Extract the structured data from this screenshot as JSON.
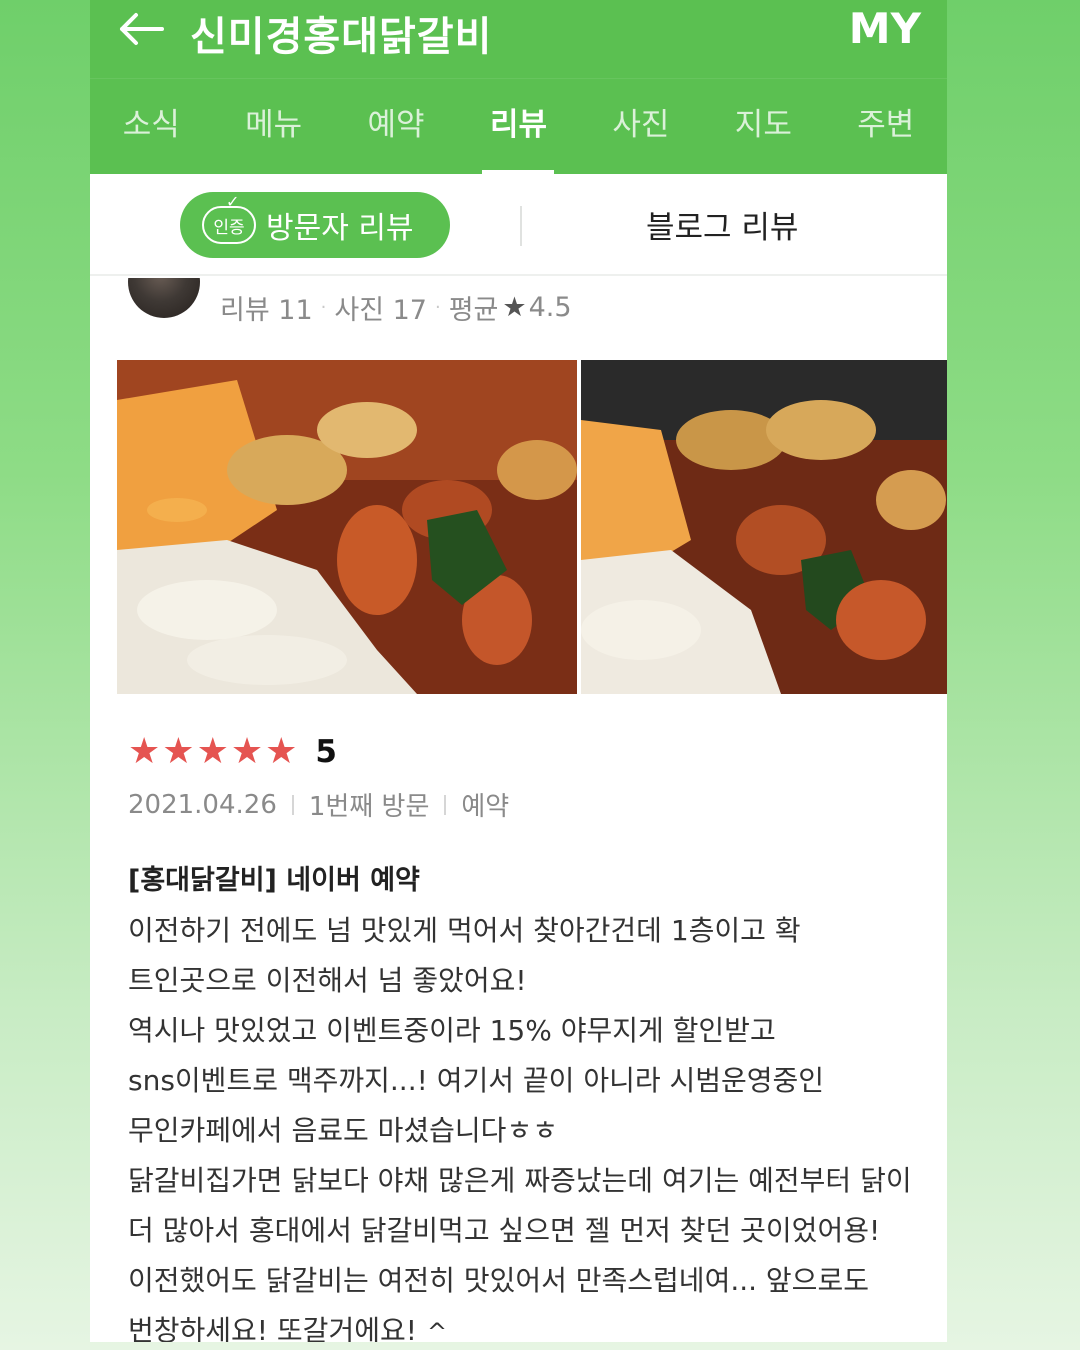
{
  "app": {
    "title": "신미경홍대닭갈비",
    "my_label": "MY"
  },
  "tabs": [
    {
      "label": "소식",
      "active": false
    },
    {
      "label": "메뉴",
      "active": false
    },
    {
      "label": "예약",
      "active": false
    },
    {
      "label": "리뷰",
      "active": true
    },
    {
      "label": "사진",
      "active": false
    },
    {
      "label": "지도",
      "active": false
    },
    {
      "label": "주변",
      "active": false
    }
  ],
  "subtabs": {
    "visitor_badge": "인증",
    "visitor_label": "방문자 리뷰",
    "blog_label": "블로그 리뷰"
  },
  "reviewer": {
    "reviews": "리뷰 11",
    "photos": "사진 17",
    "avg_label": "평균",
    "avg_star": "★",
    "avg_value": "4.5"
  },
  "review": {
    "rating": 5,
    "rating_text": "5",
    "date": "2021.04.26",
    "visit": "1번째 방문",
    "type": "예약",
    "tag": "[홍대닭갈비] 네이버 예약",
    "paragraphs": [
      "이전하기 전에도 넘 맛있게 먹어서 찾아간건데 1층이고 확 트인곳으로 이전해서 넘 좋았어요!",
      "역시나 맛있었고 이벤트중이라 15% 야무지게 할인받고 sns이벤트로 맥주까지...! 여기서 끝이 아니라 시범운영중인 무인카페에서 음료도 마셨습니다ㅎㅎ",
      "닭갈비집가면 닭보다 야채 많은게 짜증났는데 여기는 예전부터 닭이 더 많아서 홍대에서 닭갈비먹고 싶으면 젤 먼저 찾던 곳이었어용! 이전했어도 닭갈비는 여전히 맛있어서 만족스럽네여... 앞으로도 번창하세요! 또갈거에요!"
    ],
    "collapse_glyph": "^"
  },
  "colors": {
    "brand_green": "#5bc051",
    "star_red": "#e55451"
  }
}
